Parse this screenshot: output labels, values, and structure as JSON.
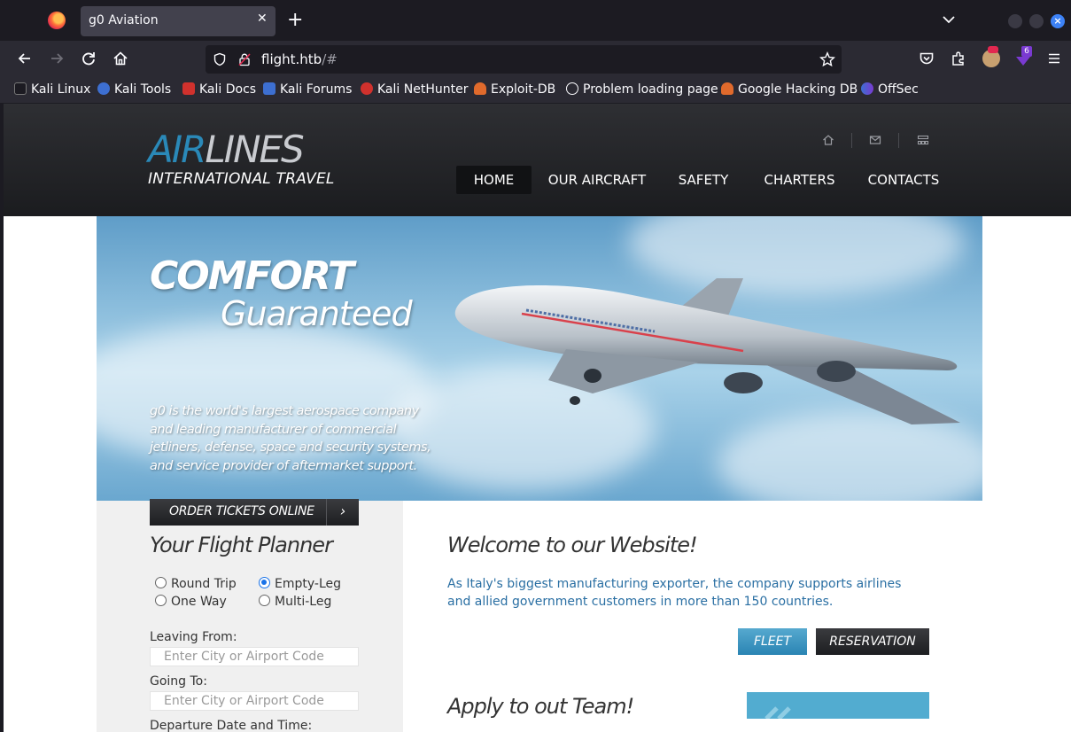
{
  "browser": {
    "tab_title": "g0 Aviation",
    "tab_close": "✕",
    "new_tab": "+",
    "url_host": "flight.htb",
    "url_path": "/#",
    "extension_badge": "6",
    "bookmarks": [
      {
        "label": "Kali Linux",
        "color": "#2a2a2a"
      },
      {
        "label": "Kali Tools",
        "color": "#3d6fd1"
      },
      {
        "label": "Kali Docs",
        "color": "#d0312d"
      },
      {
        "label": "Kali Forums",
        "color": "#3d6fd1"
      },
      {
        "label": "Kali NetHunter",
        "color": "#d0312d"
      },
      {
        "label": "Exploit-DB",
        "color": "#e06a2c"
      },
      {
        "label": "Problem loading page",
        "color": "#9e9ea6"
      },
      {
        "label": "Google Hacking DB",
        "color": "#e06a2c"
      },
      {
        "label": "OffSec",
        "color": "#3d6fd1"
      }
    ]
  },
  "site": {
    "logo_air": "AIR",
    "logo_lines": "LINES",
    "logo_sub": "INTERNATIONAL TRAVEL",
    "menu": [
      "HOME",
      "OUR AIRCRAFT",
      "SAFETY",
      "CHARTERS",
      "CONTACTS"
    ],
    "hero": {
      "title": "COMFORT",
      "subtitle": "Guaranteed",
      "text": "g0 is the world's largest aerospace company and leading manufacturer of commercial jetliners, defense, space and security systems, and service provider of aftermarket support."
    },
    "planner": {
      "order_label": "ORDER TICKETS ONLINE",
      "order_arrow": "›",
      "title": "Your Flight Planner",
      "trip_options": [
        "Round Trip",
        "One Way",
        "Empty-Leg",
        "Multi-Leg"
      ],
      "leaving_label": "Leaving From:",
      "leaving_placeholder": "Enter City or Airport Code",
      "going_label": "Going To:",
      "going_placeholder": "Enter City or Airport Code",
      "departure_label": "Departure Date and Time:"
    },
    "welcome": {
      "title": "Welcome to our Website!",
      "text": "As Italy's biggest manufacturing exporter, the company supports airlines and allied government customers in more than 150 countries.",
      "fleet_button": "FLEET",
      "reservation_button": "RESERVATION"
    },
    "apply_title": "Apply to out Team!"
  }
}
